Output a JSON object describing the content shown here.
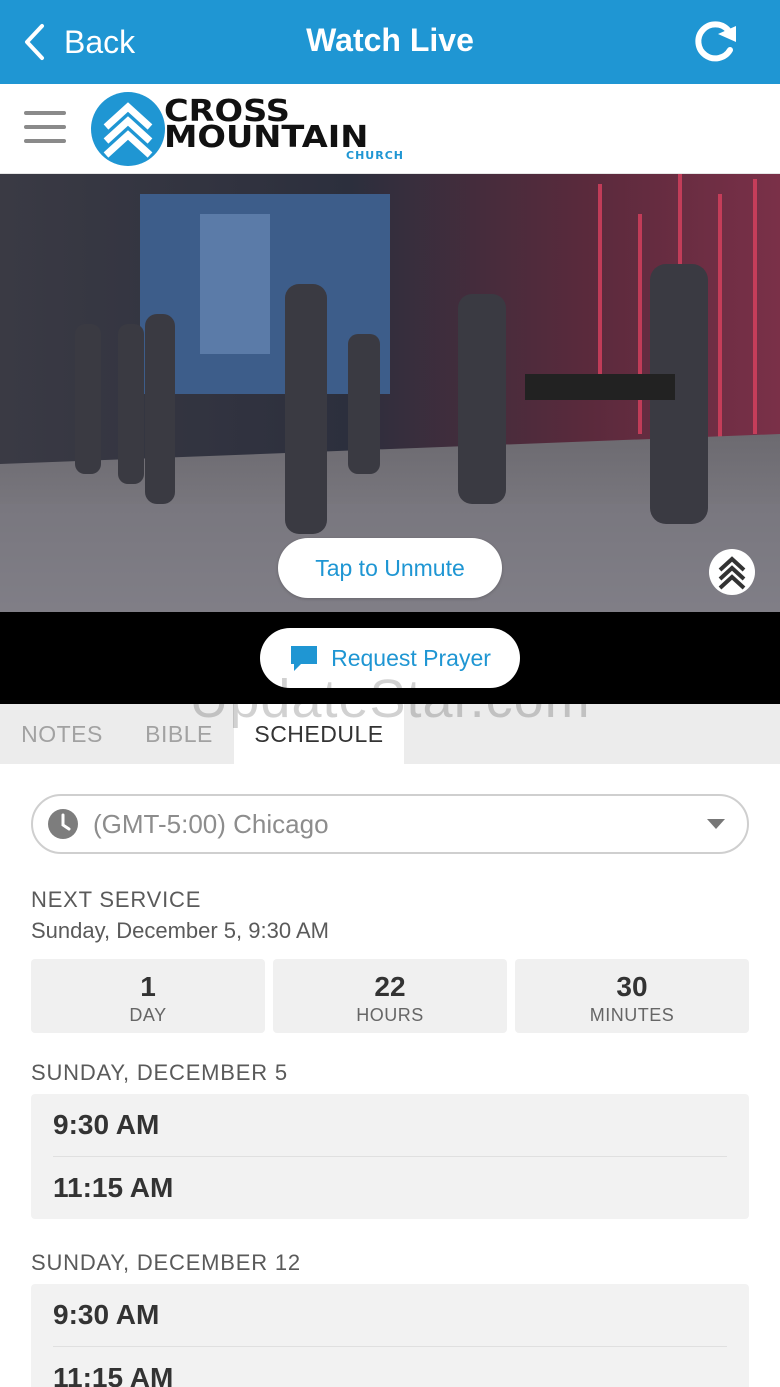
{
  "nav": {
    "back_label": "Back",
    "title": "Watch Live",
    "accent_color": "#1f96d3",
    "back_icon": "chevron-left-icon",
    "refresh_icon": "refresh-icon"
  },
  "header": {
    "menu_icon": "hamburger-menu-icon",
    "logo": {
      "line1": "CROSS",
      "line2": "MOUNTAIN",
      "line3": "CHURCH"
    }
  },
  "video": {
    "unmute_label": "Tap to Unmute",
    "badge_icon": "church-logo-icon"
  },
  "prayer": {
    "label": "Request Prayer",
    "icon": "chat-bubble-icon"
  },
  "watermark": "UpdateStar.com",
  "tabs": [
    {
      "label": "NOTES",
      "active": false
    },
    {
      "label": "BIBLE",
      "active": false
    },
    {
      "label": "SCHEDULE",
      "active": true
    }
  ],
  "timezone": {
    "value": "(GMT-5:00) Chicago",
    "icon": "clock-icon"
  },
  "next_service": {
    "label": "NEXT SERVICE",
    "date": "Sunday, December 5, 9:30 AM",
    "countdown": [
      {
        "value": "1",
        "unit": "DAY"
      },
      {
        "value": "22",
        "unit": "HOURS"
      },
      {
        "value": "30",
        "unit": "MINUTES"
      }
    ]
  },
  "schedule": [
    {
      "day": "SUNDAY, DECEMBER 5",
      "times": [
        "9:30 AM",
        "11:15 AM"
      ]
    },
    {
      "day": "SUNDAY, DECEMBER 12",
      "times": [
        "9:30 AM",
        "11:15 AM"
      ]
    }
  ]
}
